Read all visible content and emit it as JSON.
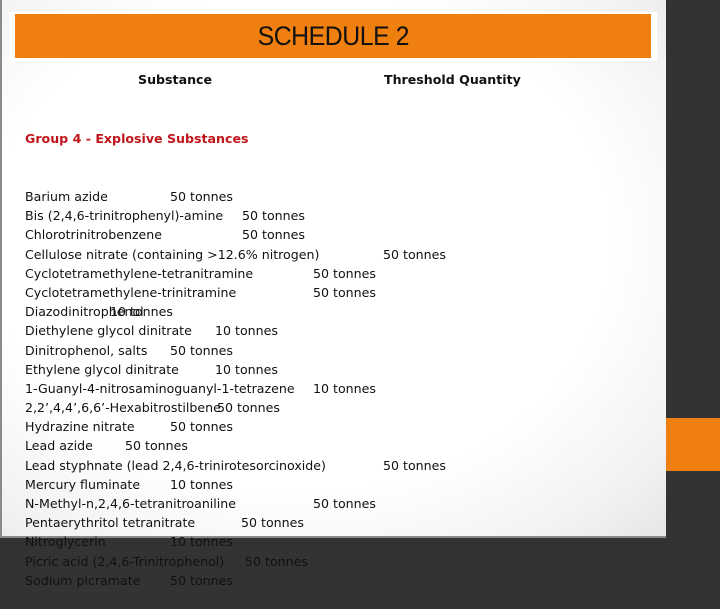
{
  "title": "SCHEDULE 2",
  "columns": {
    "substance": "Substance",
    "threshold": "Threshold Quantity"
  },
  "group_heading": "Group 4 - Explosive Substances",
  "rows": [
    {
      "name": "Barium azide",
      "qty": "50 tonnes"
    },
    {
      "name": "Bis (2,4,6-trinitrophenyl)-amine",
      "qty": "50 tonnes"
    },
    {
      "name": "Chlorotrinitrobenzene",
      "qty": "50 tonnes"
    },
    {
      "name": "Cellulose nitrate (containing >12.6% nitrogen)",
      "qty": "50 tonnes"
    },
    {
      "name": "Cyclotetramethylene-tetranitramine",
      "qty": "50 tonnes"
    },
    {
      "name": "Cyclotetramethylene-trinitramine",
      "qty": "50 tonnes"
    },
    {
      "name": "Diazodinitrophenol",
      "qty": "10 tonnes"
    },
    {
      "name": "Diethylene glycol dinitrate",
      "qty": "10 tonnes"
    },
    {
      "name": "Dinitrophenol, salts",
      "qty": "50 tonnes"
    },
    {
      "name": "Ethylene glycol dinitrate",
      "qty": "10 tonnes"
    },
    {
      "name": "1-Guanyl-4-nitrosaminoguanyl-1-tetrazene",
      "qty": "10 tonnes"
    },
    {
      "name": "2,2’,4,4’,6,6’-Hexabitrostilbene",
      "qty": "50 tonnes"
    },
    {
      "name": "Hydrazine nitrate",
      "qty": "50 tonnes"
    },
    {
      "name": "Lead azide",
      "qty": "50 tonnes"
    },
    {
      "name": "Lead styphnate (lead 2,4,6-trinirotesorcinoxide)",
      "qty": "50 tonnes"
    },
    {
      "name": "Mercury fluminate",
      "qty": "10 tonnes"
    },
    {
      "name": "N-Methyl-n,2,4,6-tetranitroaniline",
      "qty": "50 tonnes"
    },
    {
      "name": "Pentaerythritol tetranitrate",
      "qty": "50 tonnes"
    },
    {
      "name": "Nitroglycerin",
      "qty": "10 tonnes"
    },
    {
      "name": "Picric acid (2,4,6-Trinitrophenol)",
      "qty": "50 tonnes"
    },
    {
      "name": "Sodium picramate",
      "qty": "50 tonnes"
    }
  ],
  "colors": {
    "accent": "#ef7f0f",
    "group_heading": "#c0151a",
    "side_panel": "#333333"
  }
}
